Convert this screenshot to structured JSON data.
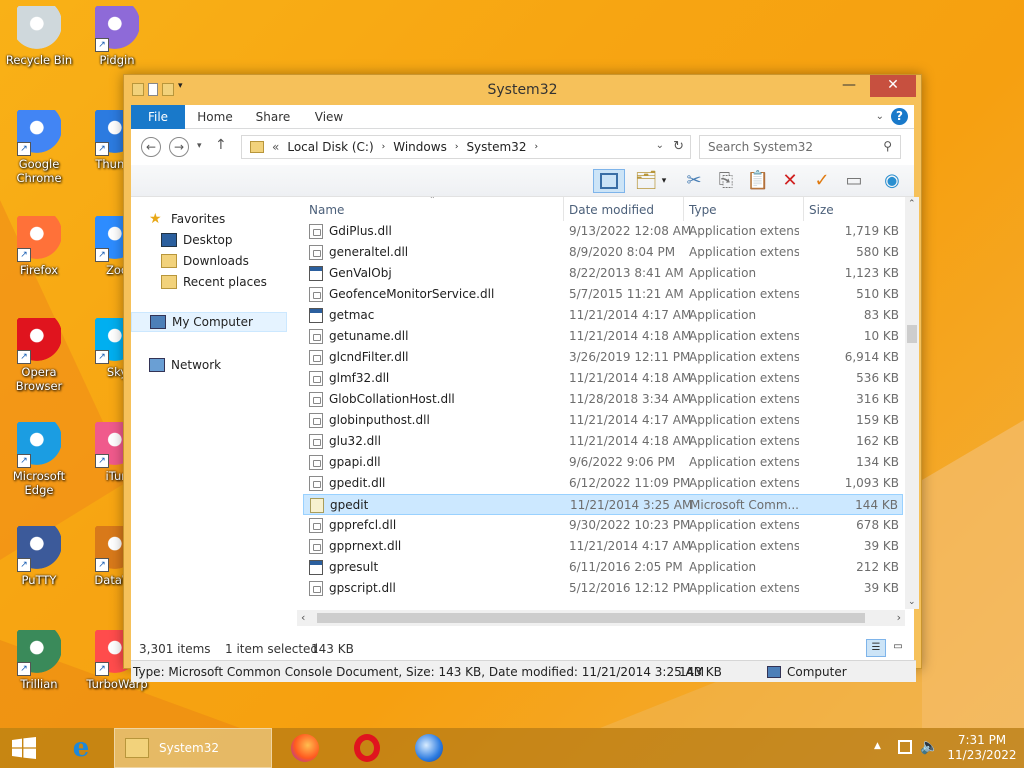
{
  "colors": {
    "accent": "#1979ca",
    "window_frame": "#f6c15a",
    "selection": "#cce8ff",
    "desktop": "#f7a512"
  },
  "desktop": {
    "icons": [
      {
        "label": "Recycle Bin",
        "icon": "recycle-bin-icon"
      },
      {
        "label": "Pidgin",
        "icon": "pidgin-icon"
      },
      {
        "label": "Google Chrome",
        "icon": "chrome-icon"
      },
      {
        "label": "Thunde",
        "icon": "thunderbird-icon"
      },
      {
        "label": "Firefox",
        "icon": "firefox-icon"
      },
      {
        "label": "Zoo",
        "icon": "zoom-icon"
      },
      {
        "label": "Opera Browser",
        "icon": "opera-icon"
      },
      {
        "label": "Sky",
        "icon": "skype-icon"
      },
      {
        "label": "Microsoft Edge",
        "icon": "edge-icon"
      },
      {
        "label": "iTun",
        "icon": "itunes-icon"
      },
      {
        "label": "PuTTY",
        "icon": "putty-icon"
      },
      {
        "label": "DataWa",
        "icon": "datawarrior-icon"
      },
      {
        "label": "Trillian",
        "icon": "trillian-icon"
      },
      {
        "label": "TurboWarp",
        "icon": "turbowarp-icon"
      }
    ]
  },
  "window": {
    "title": "System32",
    "controls": {
      "minimize": "—",
      "maximize": "☐",
      "close": "✕"
    },
    "ribbon_tabs": [
      "File",
      "Home",
      "Share",
      "View"
    ],
    "help": "?",
    "address": {
      "prefix": "«",
      "crumbs": [
        "Local Disk (C:)",
        "Windows",
        "System32"
      ]
    },
    "search_placeholder": "Search System32",
    "nav": {
      "favorites": "Favorites",
      "fav_items": [
        "Desktop",
        "Downloads",
        "Recent places"
      ],
      "computer": "My Computer",
      "network": "Network"
    },
    "columns": {
      "name": "Name",
      "date": "Date modified",
      "type": "Type",
      "size": "Size"
    },
    "files": [
      {
        "name": "GdiPlus.dll",
        "date": "9/13/2022 12:08 AM",
        "type": "Application extens...",
        "size": "1,719 KB",
        "kind": "dll"
      },
      {
        "name": "generaltel.dll",
        "date": "8/9/2020 8:04 PM",
        "type": "Application extens...",
        "size": "580 KB",
        "kind": "dll"
      },
      {
        "name": "GenValObj",
        "date": "8/22/2013 8:41 AM",
        "type": "Application",
        "size": "1,123 KB",
        "kind": "app"
      },
      {
        "name": "GeofenceMonitorService.dll",
        "date": "5/7/2015 11:21 AM",
        "type": "Application extens...",
        "size": "510 KB",
        "kind": "dll"
      },
      {
        "name": "getmac",
        "date": "11/21/2014 4:17 AM",
        "type": "Application",
        "size": "83 KB",
        "kind": "app"
      },
      {
        "name": "getuname.dll",
        "date": "11/21/2014 4:18 AM",
        "type": "Application extens...",
        "size": "10 KB",
        "kind": "dll"
      },
      {
        "name": "glcndFilter.dll",
        "date": "3/26/2019 12:11 PM",
        "type": "Application extens...",
        "size": "6,914 KB",
        "kind": "dll"
      },
      {
        "name": "glmf32.dll",
        "date": "11/21/2014 4:18 AM",
        "type": "Application extens...",
        "size": "536 KB",
        "kind": "dll"
      },
      {
        "name": "GlobCollationHost.dll",
        "date": "11/28/2018 3:34 AM",
        "type": "Application extens...",
        "size": "316 KB",
        "kind": "dll"
      },
      {
        "name": "globinputhost.dll",
        "date": "11/21/2014 4:17 AM",
        "type": "Application extens...",
        "size": "159 KB",
        "kind": "dll"
      },
      {
        "name": "glu32.dll",
        "date": "11/21/2014 4:18 AM",
        "type": "Application extens...",
        "size": "162 KB",
        "kind": "dll"
      },
      {
        "name": "gpapi.dll",
        "date": "9/6/2022 9:06 PM",
        "type": "Application extens...",
        "size": "134 KB",
        "kind": "dll"
      },
      {
        "name": "gpedit.dll",
        "date": "6/12/2022 11:09 PM",
        "type": "Application extens...",
        "size": "1,093 KB",
        "kind": "dll"
      },
      {
        "name": "gpedit",
        "date": "11/21/2014 3:25 AM",
        "type": "Microsoft Comm...",
        "size": "144 KB",
        "kind": "msc",
        "selected": true
      },
      {
        "name": "gpprefcl.dll",
        "date": "9/30/2022 10:23 PM",
        "type": "Application extens...",
        "size": "678 KB",
        "kind": "dll"
      },
      {
        "name": "gpprnext.dll",
        "date": "11/21/2014 4:17 AM",
        "type": "Application extens...",
        "size": "39 KB",
        "kind": "dll"
      },
      {
        "name": "gpresult",
        "date": "6/11/2016 2:05 PM",
        "type": "Application",
        "size": "212 KB",
        "kind": "app"
      },
      {
        "name": "gpscript.dll",
        "date": "5/12/2016 12:12 PM",
        "type": "Application extens...",
        "size": "39 KB",
        "kind": "dll"
      }
    ],
    "status": {
      "count": "3,301 items",
      "selected": "1 item selected",
      "size": "143 KB"
    },
    "details": {
      "text": "Type: Microsoft Common Console Document, Size: 143 KB, Date modified: 11/21/2014 3:25 AM",
      "size": "143 KB",
      "location": "Computer"
    }
  },
  "taskbar": {
    "active_label": "System32",
    "time": "7:31 PM",
    "date": "11/23/2022",
    "tray_expand": "▲"
  }
}
